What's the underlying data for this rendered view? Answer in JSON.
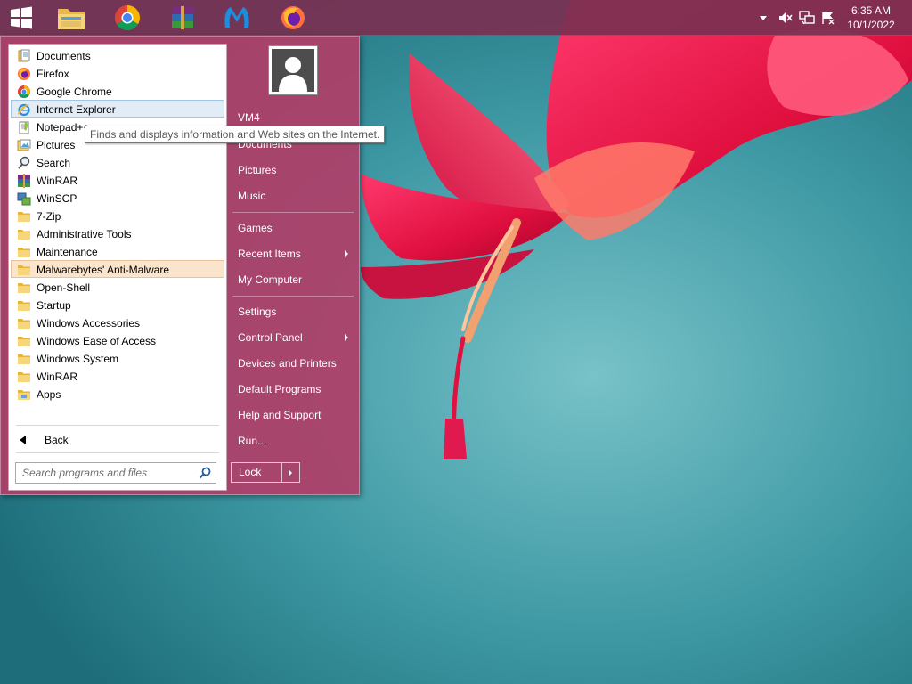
{
  "taskbar": {
    "pinned": [
      {
        "name": "start-button",
        "icon": "windows-logo-icon"
      },
      {
        "name": "file-explorer",
        "icon": "folder-icon"
      },
      {
        "name": "google-chrome",
        "icon": "chrome-icon"
      },
      {
        "name": "winrar",
        "icon": "winrar-icon"
      },
      {
        "name": "malwarebytes",
        "icon": "malwarebytes-icon"
      },
      {
        "name": "firefox",
        "icon": "firefox-icon"
      }
    ],
    "tray": {
      "icons": [
        "show-hidden-icons-icon",
        "volume-muted-icon",
        "network-icon",
        "action-center-flag-icon"
      ],
      "time": "6:35 AM",
      "date": "10/1/2022"
    }
  },
  "start_menu": {
    "programs": [
      {
        "label": "Documents",
        "icon": "documents-icon"
      },
      {
        "label": "Firefox",
        "icon": "firefox-icon"
      },
      {
        "label": "Google Chrome",
        "icon": "chrome-icon"
      },
      {
        "label": "Internet Explorer",
        "icon": "internet-explorer-icon",
        "state": "hover"
      },
      {
        "label": "Notepad++",
        "icon": "notepadpp-icon"
      },
      {
        "label": "Pictures",
        "icon": "pictures-icon"
      },
      {
        "label": "Search",
        "icon": "search-icon"
      },
      {
        "label": "WinRAR",
        "icon": "winrar-icon"
      },
      {
        "label": "WinSCP",
        "icon": "winscp-icon"
      },
      {
        "label": "7-Zip",
        "icon": "folder-icon"
      },
      {
        "label": "Administrative Tools",
        "icon": "folder-icon"
      },
      {
        "label": "Maintenance",
        "icon": "folder-icon"
      },
      {
        "label": "Malwarebytes' Anti-Malware",
        "icon": "folder-icon",
        "state": "selected"
      },
      {
        "label": "Open-Shell",
        "icon": "folder-icon"
      },
      {
        "label": "Startup",
        "icon": "folder-icon"
      },
      {
        "label": "Windows Accessories",
        "icon": "folder-icon"
      },
      {
        "label": "Windows Ease of Access",
        "icon": "folder-icon"
      },
      {
        "label": "Windows System",
        "icon": "folder-icon"
      },
      {
        "label": "WinRAR",
        "icon": "folder-icon"
      },
      {
        "label": "Apps",
        "icon": "apps-icon"
      }
    ],
    "back_label": "Back",
    "search_placeholder": "Search programs and files",
    "tooltip": "Finds and displays information and Web sites on the Internet.",
    "user_name": "VM4",
    "right_items": [
      {
        "label": "VM4"
      },
      {
        "label": "Documents"
      },
      {
        "label": "Pictures"
      },
      {
        "label": "Music"
      },
      {
        "label": "Games"
      },
      {
        "label": "Recent Items",
        "submenu": true
      },
      {
        "label": "My Computer"
      },
      {
        "label": "Settings"
      },
      {
        "label": "Control Panel",
        "submenu": true
      },
      {
        "label": "Devices and Printers"
      },
      {
        "label": "Default Programs"
      },
      {
        "label": "Help and Support"
      },
      {
        "label": "Run..."
      }
    ],
    "lock_label": "Lock"
  },
  "colors": {
    "menu_accent": "#b03e68",
    "taskbar": "#7a3052",
    "hover_bg": "#e1ecf7",
    "selected_bg": "#fbe4cc"
  }
}
